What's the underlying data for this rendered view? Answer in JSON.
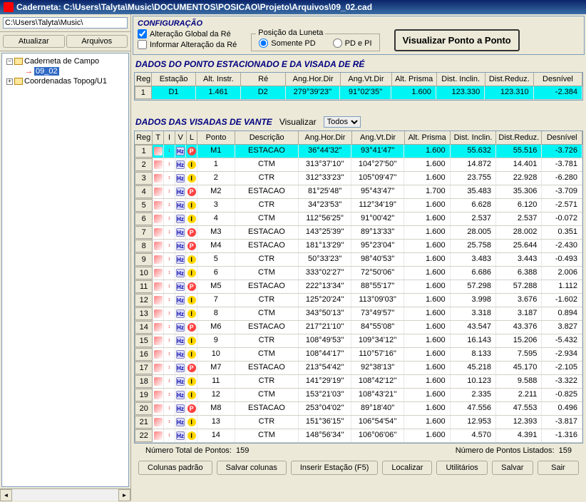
{
  "title": "Caderneta: C:\\Users\\Talyta\\Music\\DOCUMENTOS\\POSICAO\\Projeto\\Arquivos\\09_02.cad",
  "leftpane": {
    "path": "C:\\Users\\Talyta\\Music\\",
    "btn_atualizar": "Atualizar",
    "btn_arquivos": "Arquivos",
    "tree": {
      "root": "Caderneta de Campo",
      "item1": "09_02",
      "item2": "Coordenadas Topog/U1"
    }
  },
  "config": {
    "title": "CONFIGURAÇÃO",
    "chk1": "Alteração Global da Ré",
    "chk2": "Informar Alteração da Ré",
    "radio_legend": "Posição da Luneta",
    "radio1": "Somente PD",
    "radio2": "PD e PI",
    "big_btn": "Visualizar Ponto a Ponto"
  },
  "section1": {
    "title": "DADOS DO PONTO ESTACIONADO E DA VISADA DE RÉ",
    "headers": [
      "Reg",
      "Estação",
      "Alt. Instr.",
      "Ré",
      "Ang.Hor.Dir",
      "Ang.Vt.Dir",
      "Alt. Prisma",
      "Dist. Inclin.",
      "Dist.Reduz.",
      "Desnível"
    ],
    "row": [
      "1",
      "D1",
      "1.461",
      "D2",
      "279°39'23''",
      "91°02'35''",
      "1.600",
      "123.330",
      "123.310",
      "-2.384"
    ]
  },
  "section2": {
    "title": "DADOS DAS VISADAS DE VANTE",
    "visualizar_label": "Visualizar",
    "visualizar_value": "Todos",
    "headers": [
      "Reg",
      "T",
      "I",
      "V",
      "L",
      "Ponto",
      "Descrição",
      "Ang.Hor.Dir",
      "Ang.Vt.Dir",
      "Alt. Prisma",
      "Dist. Inclin.",
      "Dist.Reduz.",
      "Desnível"
    ],
    "rows": [
      {
        "reg": "1",
        "ptype": "P",
        "ponto": "M1",
        "desc": "ESTACAO",
        "ahd": "36°44'32''",
        "avd": "93°41'47''",
        "alt": "1.600",
        "di": "55.632",
        "dr": "55.516",
        "dn": "-3.726"
      },
      {
        "reg": "2",
        "ptype": "I",
        "ponto": "1",
        "desc": "CTM",
        "ahd": "313°37'10''",
        "avd": "104°27'50''",
        "alt": "1.600",
        "di": "14.872",
        "dr": "14.401",
        "dn": "-3.781"
      },
      {
        "reg": "3",
        "ptype": "I",
        "ponto": "2",
        "desc": "CTR",
        "ahd": "312°33'23''",
        "avd": "105°09'47''",
        "alt": "1.600",
        "di": "23.755",
        "dr": "22.928",
        "dn": "-6.280"
      },
      {
        "reg": "4",
        "ptype": "P",
        "ponto": "M2",
        "desc": "ESTACAO",
        "ahd": "81°25'48''",
        "avd": "95°43'47''",
        "alt": "1.700",
        "di": "35.483",
        "dr": "35.306",
        "dn": "-3.709"
      },
      {
        "reg": "5",
        "ptype": "I",
        "ponto": "3",
        "desc": "CTR",
        "ahd": "34°23'53''",
        "avd": "112°34'19''",
        "alt": "1.600",
        "di": "6.628",
        "dr": "6.120",
        "dn": "-2.571"
      },
      {
        "reg": "6",
        "ptype": "I",
        "ponto": "4",
        "desc": "CTM",
        "ahd": "112°56'25''",
        "avd": "91°00'42''",
        "alt": "1.600",
        "di": "2.537",
        "dr": "2.537",
        "dn": "-0.072"
      },
      {
        "reg": "7",
        "ptype": "P",
        "ponto": "M3",
        "desc": "ESTACAO",
        "ahd": "143°25'39''",
        "avd": "89°13'33''",
        "alt": "1.600",
        "di": "28.005",
        "dr": "28.002",
        "dn": "0.351"
      },
      {
        "reg": "8",
        "ptype": "P",
        "ponto": "M4",
        "desc": "ESTACAO",
        "ahd": "181°13'29''",
        "avd": "95°23'04''",
        "alt": "1.600",
        "di": "25.758",
        "dr": "25.644",
        "dn": "-2.430"
      },
      {
        "reg": "9",
        "ptype": "I",
        "ponto": "5",
        "desc": "CTR",
        "ahd": "50°33'23''",
        "avd": "98°40'53''",
        "alt": "1.600",
        "di": "3.483",
        "dr": "3.443",
        "dn": "-0.493"
      },
      {
        "reg": "10",
        "ptype": "I",
        "ponto": "6",
        "desc": "CTM",
        "ahd": "333°02'27''",
        "avd": "72°50'06''",
        "alt": "1.600",
        "di": "6.686",
        "dr": "6.388",
        "dn": "2.006"
      },
      {
        "reg": "11",
        "ptype": "P",
        "ponto": "M5",
        "desc": "ESTACAO",
        "ahd": "222°13'34''",
        "avd": "88°55'17''",
        "alt": "1.600",
        "di": "57.298",
        "dr": "57.288",
        "dn": "1.112"
      },
      {
        "reg": "12",
        "ptype": "I",
        "ponto": "7",
        "desc": "CTR",
        "ahd": "125°20'24''",
        "avd": "113°09'03''",
        "alt": "1.600",
        "di": "3.998",
        "dr": "3.676",
        "dn": "-1.602"
      },
      {
        "reg": "13",
        "ptype": "I",
        "ponto": "8",
        "desc": "CTM",
        "ahd": "343°50'13''",
        "avd": "73°49'57''",
        "alt": "1.600",
        "di": "3.318",
        "dr": "3.187",
        "dn": "0.894"
      },
      {
        "reg": "14",
        "ptype": "P",
        "ponto": "M6",
        "desc": "ESTACAO",
        "ahd": "217°21'10''",
        "avd": "84°55'08''",
        "alt": "1.600",
        "di": "43.547",
        "dr": "43.376",
        "dn": "3.827"
      },
      {
        "reg": "15",
        "ptype": "I",
        "ponto": "9",
        "desc": "CTR",
        "ahd": "108°49'53''",
        "avd": "109°34'12''",
        "alt": "1.600",
        "di": "16.143",
        "dr": "15.206",
        "dn": "-5.432"
      },
      {
        "reg": "16",
        "ptype": "I",
        "ponto": "10",
        "desc": "CTM",
        "ahd": "108°44'17''",
        "avd": "110°57'16''",
        "alt": "1.600",
        "di": "8.133",
        "dr": "7.595",
        "dn": "-2.934"
      },
      {
        "reg": "17",
        "ptype": "P",
        "ponto": "M7",
        "desc": "ESTACAO",
        "ahd": "213°54'42''",
        "avd": "92°38'13''",
        "alt": "1.600",
        "di": "45.218",
        "dr": "45.170",
        "dn": "-2.105"
      },
      {
        "reg": "18",
        "ptype": "I",
        "ponto": "11",
        "desc": "CTR",
        "ahd": "141°29'19''",
        "avd": "108°42'12''",
        "alt": "1.600",
        "di": "10.123",
        "dr": "9.588",
        "dn": "-3.322"
      },
      {
        "reg": "19",
        "ptype": "I",
        "ponto": "12",
        "desc": "CTM",
        "ahd": "153°21'03''",
        "avd": "108°43'21''",
        "alt": "1.600",
        "di": "2.335",
        "dr": "2.211",
        "dn": "-0.825"
      },
      {
        "reg": "20",
        "ptype": "P",
        "ponto": "M8",
        "desc": "ESTACAO",
        "ahd": "253°04'02''",
        "avd": "89°18'40''",
        "alt": "1.600",
        "di": "47.556",
        "dr": "47.553",
        "dn": "0.496"
      },
      {
        "reg": "21",
        "ptype": "I",
        "ponto": "13",
        "desc": "CTR",
        "ahd": "151°36'15''",
        "avd": "106°54'54''",
        "alt": "1.600",
        "di": "12.953",
        "dr": "12.393",
        "dn": "-3.817"
      },
      {
        "reg": "22",
        "ptype": "I",
        "ponto": "14",
        "desc": "CTM",
        "ahd": "148°56'34''",
        "avd": "106°06'06''",
        "alt": "1.600",
        "di": "4.570",
        "dr": "4.391",
        "dn": "-1.316"
      }
    ]
  },
  "footer": {
    "total_label": "Número Total de Pontos:",
    "total_value": "159",
    "listed_label": "Número de Pontos Listados:",
    "listed_value": "159",
    "btns": {
      "colunas_padrao": "Colunas padrão",
      "salvar_colunas": "Salvar colunas",
      "inserir_estacao": "Inserir Estação (F5)",
      "localizar": "Localizar",
      "utilitarios": "Utilitários",
      "salvar": "Salvar",
      "sair": "Sair"
    }
  }
}
